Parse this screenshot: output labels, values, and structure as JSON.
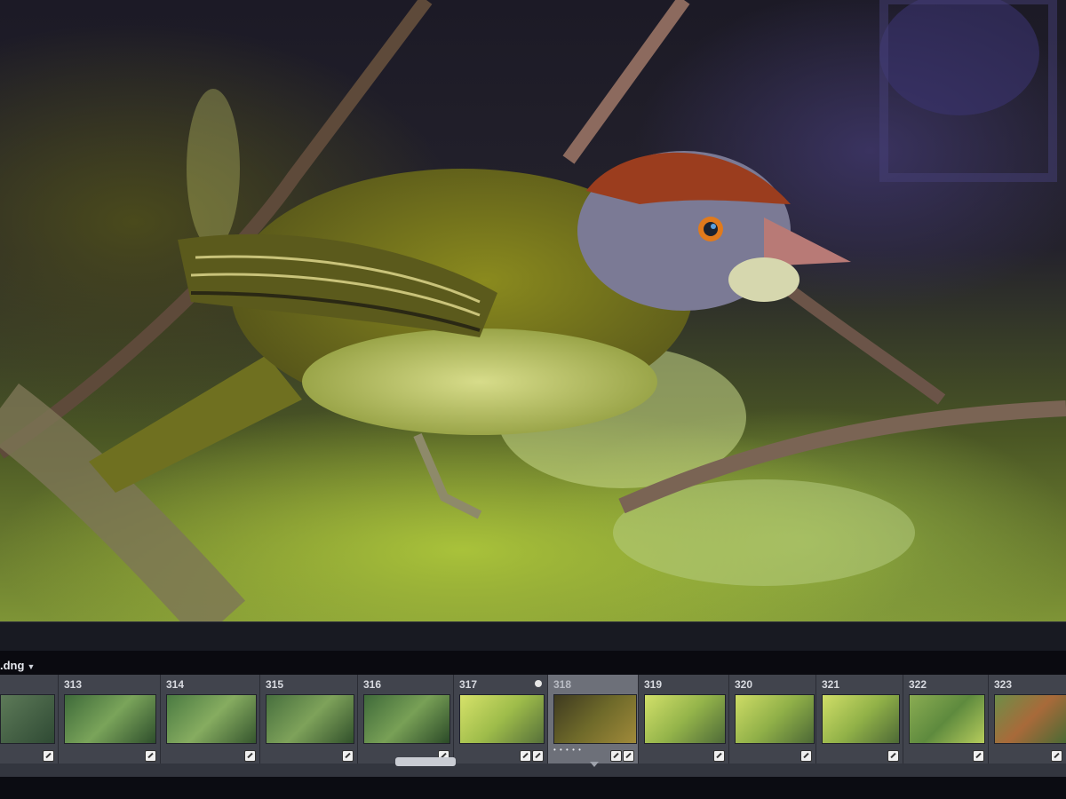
{
  "app": {
    "accent": "#6d7079",
    "background": "#0a0a10"
  },
  "photo": {
    "alt": "Bird photo"
  },
  "filmstrip": {
    "filename_label": ".dng",
    "dropdown_icon": "caret-down-icon",
    "selected_index": 6,
    "items": [
      {
        "number": "",
        "badge": "edit-badge-icon"
      },
      {
        "number": "313",
        "badge": "edit-badge-icon"
      },
      {
        "number": "314",
        "badge": "edit-badge-icon"
      },
      {
        "number": "315",
        "badge": "edit-badge-icon"
      },
      {
        "number": "316",
        "badge": "edit-badge-icon"
      },
      {
        "number": "317",
        "badge": "edit-badge-icon"
      },
      {
        "number": "318",
        "badge": "edit-badge-icon",
        "rating": "• • • • •"
      },
      {
        "number": "319",
        "badge": "edit-badge-icon"
      },
      {
        "number": "320",
        "badge": "edit-badge-icon"
      },
      {
        "number": "321",
        "badge": "edit-badge-icon"
      },
      {
        "number": "322",
        "badge": "edit-badge-icon"
      },
      {
        "number": "323",
        "badge": "edit-badge-icon"
      }
    ]
  }
}
